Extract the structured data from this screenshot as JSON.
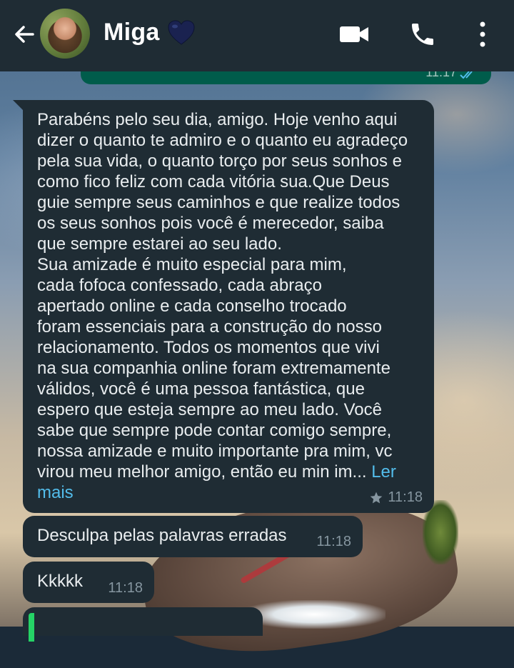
{
  "header": {
    "contact_name": "Miga",
    "name_emoji": "dark-blue-heart",
    "back_icon": "arrow-left-icon",
    "avatar": "contact-avatar",
    "actions": [
      "video-call-icon",
      "voice-call-icon",
      "more-vert-icon"
    ]
  },
  "messages": {
    "partial_out": {
      "time": "11:17",
      "status_icon": "double-check-icon"
    },
    "main": {
      "text": "Parabéns pelo seu dia, amigo. Hoje venho aqui\ndizer o quanto te admiro e o quanto eu agradeço\npela sua vida, o quanto torço por seus sonhos e\ncomo fico feliz com cada vitória sua.Que Deus\nguie sempre seus caminhos e que realize todos\nos seus sonhos pois você é merecedor, saiba\nque sempre estarei ao seu lado.\nSua amizade é muito especial para mim,\ncada fofoca confessado, cada abraço\napertado online e cada conselho trocado\nforam essenciais para a construção do nosso\nrelacionamento. Todos os momentos que vivi\nna sua companhia online foram extremamente\nválidos, você é uma pessoa fantástica, que\nespero que esteja sempre ao meu lado. Você\nsabe que sempre pode contar comigo sempre,\nnossa amizade e muito importante pra mim, vc\nvirou meu melhor amigo, então eu min im... ",
      "read_more": "Ler\nmais",
      "time": "11:18",
      "starred": true
    },
    "second": {
      "text": "Desculpa pelas palavras erradas",
      "time": "11:18"
    },
    "third": {
      "text": "Kkkkk",
      "time": "11:18"
    }
  },
  "colors": {
    "header_bg": "#1f2c34",
    "bubble_in": "#1f2c34",
    "bubble_out": "#005c4b",
    "link": "#53bdeb",
    "meta": "#8696a0"
  }
}
